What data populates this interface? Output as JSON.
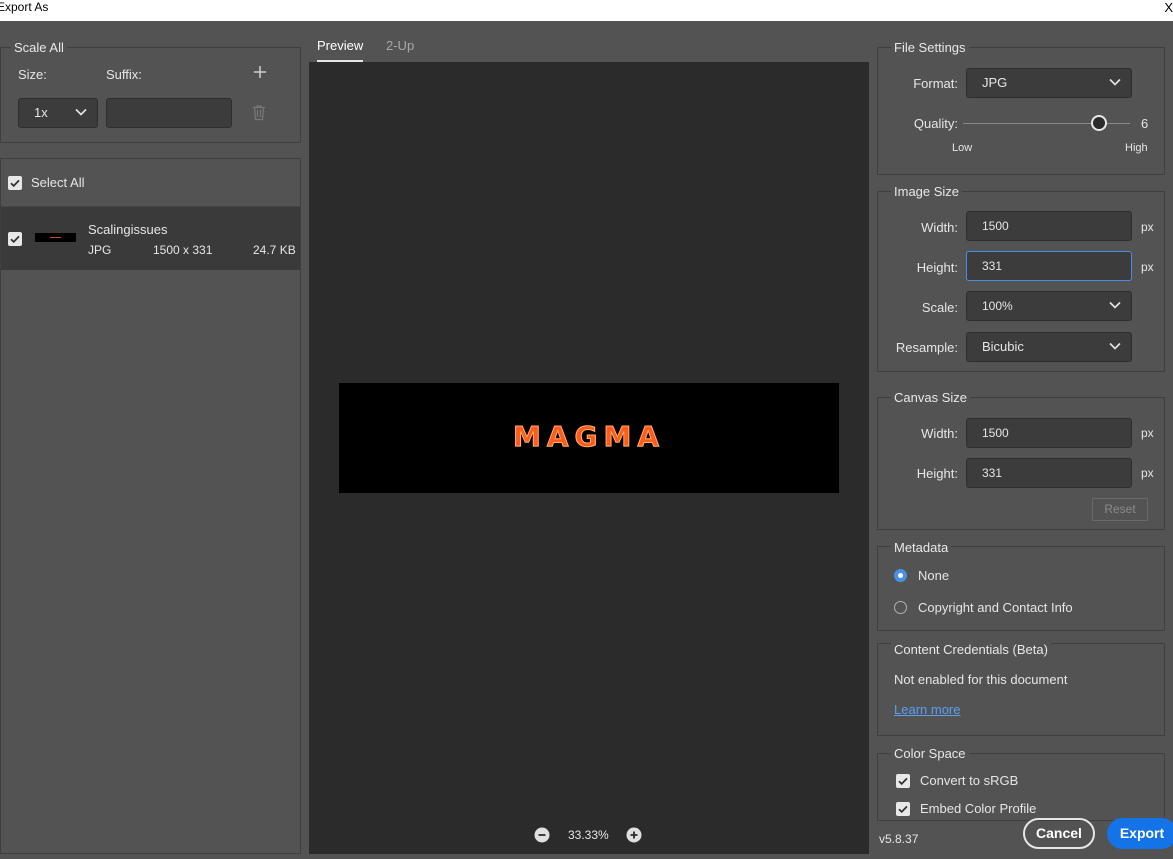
{
  "window": {
    "title": "Export As",
    "close_glyph": "X"
  },
  "scale_all": {
    "heading": "Scale All",
    "size_label": "Size:",
    "suffix_label": "Suffix:",
    "size_value": "1x",
    "suffix_value": ""
  },
  "asset_list": {
    "select_all_label": "Select All",
    "items": [
      {
        "name": "Scalingissues",
        "format": "JPG",
        "dimensions": "1500 x 331",
        "filesize": "24.7 KB"
      }
    ]
  },
  "preview": {
    "tabs": [
      {
        "label": "Preview"
      },
      {
        "label": "2-Up"
      }
    ],
    "active_tab": "Preview",
    "image_text": "MAGMA",
    "zoom": "33.33%"
  },
  "file_settings": {
    "heading": "File Settings",
    "format_label": "Format:",
    "format_value": "JPG",
    "quality_label": "Quality:",
    "quality_value": "6",
    "quality_low": "Low",
    "quality_high": "High",
    "quality_fraction": 0.78
  },
  "image_size": {
    "heading": "Image Size",
    "width_label": "Width:",
    "width_value": "1500",
    "height_label": "Height:",
    "height_value": "331",
    "scale_label": "Scale:",
    "scale_value": "100%",
    "resample_label": "Resample:",
    "resample_value": "Bicubic",
    "unit": "px"
  },
  "canvas_size": {
    "heading": "Canvas Size",
    "width_label": "Width:",
    "width_value": "1500",
    "height_label": "Height:",
    "height_value": "331",
    "unit": "px",
    "reset_label": "Reset"
  },
  "metadata": {
    "heading": "Metadata",
    "options": [
      {
        "label": "None",
        "selected": true
      },
      {
        "label": "Copyright and Contact Info",
        "selected": false
      }
    ]
  },
  "content_credentials": {
    "heading": "Content Credentials (Beta)",
    "status": "Not enabled for this document",
    "link": "Learn more"
  },
  "color_space": {
    "heading": "Color Space",
    "convert_label": "Convert to sRGB",
    "embed_label": "Embed Color Profile"
  },
  "footer": {
    "version": "v5.8.37",
    "cancel_label": "Cancel",
    "export_label": "Export"
  },
  "colors": {
    "accent": "#1473e6",
    "panel": "#535353",
    "preview_bg": "#2b2b2b",
    "focus": "#4a90e2"
  }
}
